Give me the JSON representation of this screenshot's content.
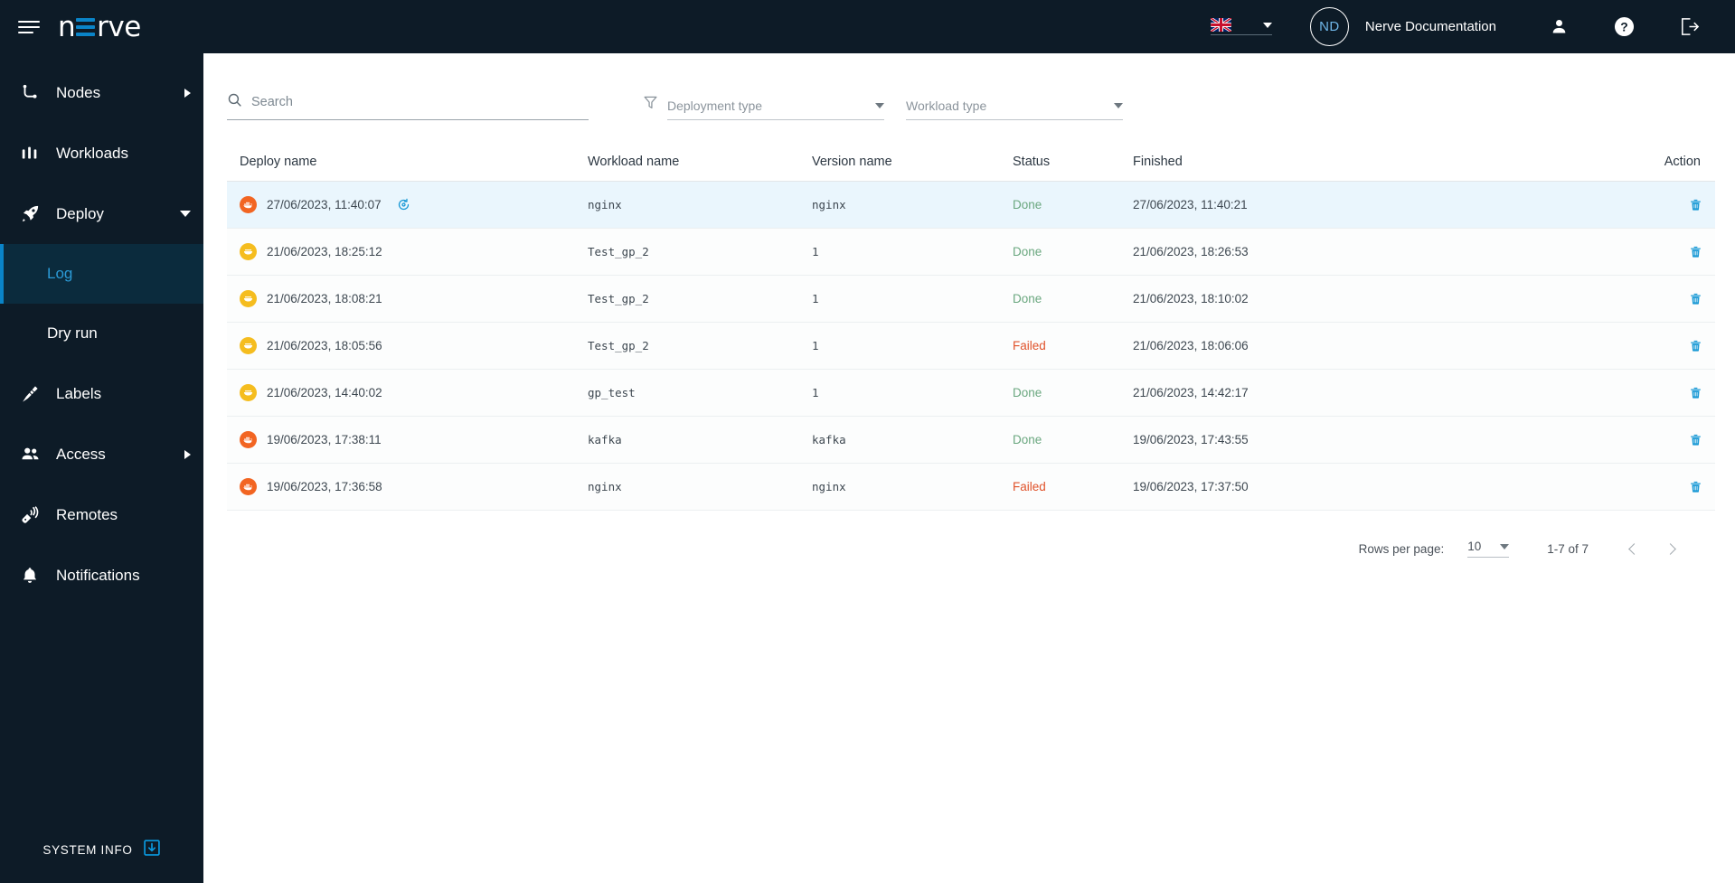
{
  "header": {
    "logo_text_start": "n",
    "logo_text_end": "rve",
    "language": "en-GB",
    "avatar_initials": "ND",
    "username": "Nerve Documentation",
    "icons": {
      "burger": "hamburger-menu-icon",
      "user": "user-icon",
      "help": "help-icon",
      "logout": "logout-icon"
    }
  },
  "sidebar": {
    "items": [
      {
        "label": "Nodes",
        "icon": "nodes-icon",
        "arrow": "right"
      },
      {
        "label": "Workloads",
        "icon": "workloads-icon",
        "arrow": "none"
      },
      {
        "label": "Deploy",
        "icon": "deploy-rocket-icon",
        "arrow": "down"
      }
    ],
    "sub_items": [
      {
        "label": "Log",
        "active": true
      },
      {
        "label": "Dry run",
        "active": false
      }
    ],
    "items_after": [
      {
        "label": "Labels",
        "icon": "labels-tag-icon",
        "arrow": "none"
      },
      {
        "label": "Access",
        "icon": "access-users-icon",
        "arrow": "right"
      },
      {
        "label": "Remotes",
        "icon": "remotes-icon",
        "arrow": "none"
      },
      {
        "label": "Notifications",
        "icon": "notifications-bell-icon",
        "arrow": "none"
      }
    ],
    "system_info": {
      "label": "SYSTEM INFO",
      "icon": "download-box-icon"
    }
  },
  "filters": {
    "search_placeholder": "Search",
    "search_value": "",
    "filter_icon": "funnel-filter-icon",
    "deployment_type": {
      "label": "Deployment type",
      "value": ""
    },
    "workload_type": {
      "label": "Workload type",
      "value": ""
    }
  },
  "table": {
    "columns": [
      "Deploy name",
      "Workload name",
      "Version name",
      "Status",
      "Finished",
      "Action"
    ],
    "rows": [
      {
        "deploy_name": "27/06/2023, 11:40:07",
        "workload_name": "nginx",
        "version_name": "nginx",
        "status": "Done",
        "finished": "27/06/2023, 11:40:21",
        "type_icon": "docker-icon",
        "type_color": "#f26522",
        "has_redeploy": true,
        "selected": true,
        "action_icon": "trash-icon"
      },
      {
        "deploy_name": "21/06/2023, 18:25:12",
        "workload_name": "Test_gp_2",
        "version_name": "1",
        "status": "Done",
        "finished": "21/06/2023, 18:26:53",
        "type_icon": "docker-compose-icon",
        "type_color": "#f5bd1f",
        "has_redeploy": false,
        "selected": false,
        "action_icon": "trash-icon"
      },
      {
        "deploy_name": "21/06/2023, 18:08:21",
        "workload_name": "Test_gp_2",
        "version_name": "1",
        "status": "Done",
        "finished": "21/06/2023, 18:10:02",
        "type_icon": "docker-compose-icon",
        "type_color": "#f5bd1f",
        "has_redeploy": false,
        "selected": false,
        "action_icon": "trash-icon"
      },
      {
        "deploy_name": "21/06/2023, 18:05:56",
        "workload_name": "Test_gp_2",
        "version_name": "1",
        "status": "Failed",
        "finished": "21/06/2023, 18:06:06",
        "type_icon": "docker-compose-icon",
        "type_color": "#f5bd1f",
        "has_redeploy": false,
        "selected": false,
        "action_icon": "trash-icon"
      },
      {
        "deploy_name": "21/06/2023, 14:40:02",
        "workload_name": "gp_test",
        "version_name": "1",
        "status": "Done",
        "finished": "21/06/2023, 14:42:17",
        "type_icon": "docker-compose-icon",
        "type_color": "#f5bd1f",
        "has_redeploy": false,
        "selected": false,
        "action_icon": "trash-icon"
      },
      {
        "deploy_name": "19/06/2023, 17:38:11",
        "workload_name": "kafka",
        "version_name": "kafka",
        "status": "Done",
        "finished": "19/06/2023, 17:43:55",
        "type_icon": "docker-icon",
        "type_color": "#f26522",
        "has_redeploy": false,
        "selected": false,
        "action_icon": "trash-icon"
      },
      {
        "deploy_name": "19/06/2023, 17:36:58",
        "workload_name": "nginx",
        "version_name": "nginx",
        "status": "Failed",
        "finished": "19/06/2023, 17:37:50",
        "type_icon": "docker-icon",
        "type_color": "#f26522",
        "has_redeploy": false,
        "selected": false,
        "action_icon": "trash-icon"
      }
    ]
  },
  "pagination": {
    "rows_per_page_label": "Rows per page:",
    "rows_per_page_value": "10",
    "range": "1-7 of 7",
    "prev_icon": "chevron-left-icon",
    "next_icon": "chevron-right-icon"
  },
  "colors": {
    "nav_bg": "#0d1b27",
    "accent": "#0a84c8",
    "active_sub_bg": "#0b2b3d",
    "selected_row": "#eaf6fd",
    "done": "#6aa77f",
    "failed": "#e0522a"
  }
}
